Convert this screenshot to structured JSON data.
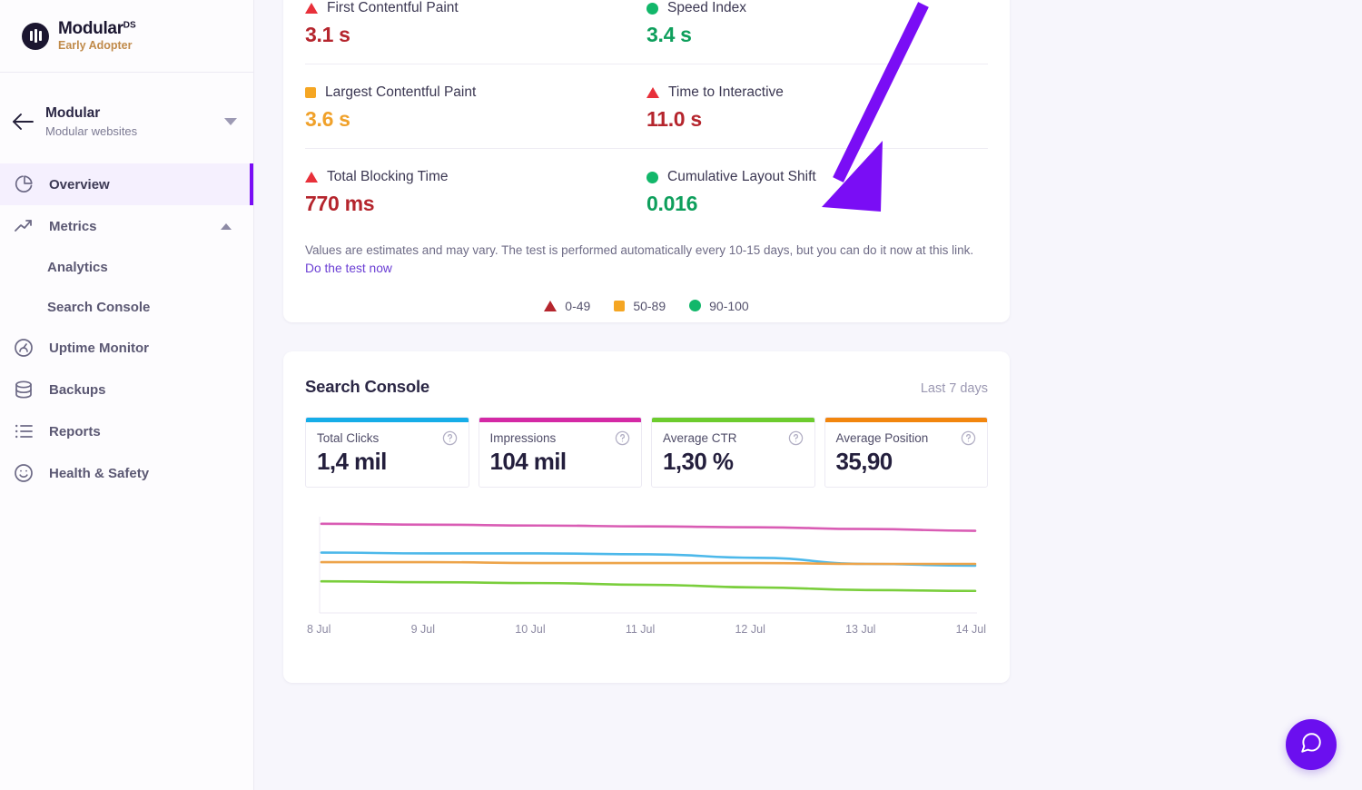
{
  "sidebar": {
    "brand": {
      "name": "Modular",
      "superscript": "DS",
      "tagline": "Early Adopter",
      "logo_icon": "modular-logo-icon"
    },
    "site_switcher": {
      "name": "Modular",
      "subtitle": "Modular websites",
      "back_icon": "arrow-left-icon",
      "caret_icon": "caret-down-icon"
    },
    "items": [
      {
        "label": "Overview",
        "icon": "pie-chart-icon",
        "active": true
      },
      {
        "label": "Metrics",
        "icon": "trending-up-icon",
        "active": false,
        "expanded": true
      },
      {
        "label": "Analytics",
        "icon": "",
        "sub": true
      },
      {
        "label": "Search Console",
        "icon": "",
        "sub": true
      },
      {
        "label": "Uptime Monitor",
        "icon": "gauge-icon",
        "active": false
      },
      {
        "label": "Backups",
        "icon": "database-icon",
        "active": false
      },
      {
        "label": "Reports",
        "icon": "list-icon",
        "active": false
      },
      {
        "label": "Health & Safety",
        "icon": "smiley-icon",
        "active": false
      }
    ]
  },
  "performance": {
    "metrics": [
      {
        "label": "First Contentful Paint",
        "value": "3.1 s",
        "status": "poor",
        "icon": "triangle-icon"
      },
      {
        "label": "Speed Index",
        "value": "3.4 s",
        "status": "good",
        "icon": "circle-icon"
      },
      {
        "label": "Largest Contentful Paint",
        "value": "3.6 s",
        "status": "average",
        "icon": "square-icon"
      },
      {
        "label": "Time to Interactive",
        "value": "11.0 s",
        "status": "poor",
        "icon": "triangle-icon"
      },
      {
        "label": "Total Blocking Time",
        "value": "770 ms",
        "status": "poor",
        "icon": "triangle-icon"
      },
      {
        "label": "Cumulative Layout Shift",
        "value": "0.016",
        "status": "good",
        "icon": "circle-icon"
      }
    ],
    "note": "Values are estimates and may vary. The test is performed automatically every 10-15 days, but you can do it now at this link.",
    "link_label": "Do the test now",
    "legend": [
      {
        "label": "0-49",
        "icon": "triangle-icon",
        "color": "#b5252d"
      },
      {
        "label": "50-89",
        "icon": "square-icon",
        "color": "#f5a623"
      },
      {
        "label": "90-100",
        "icon": "circle-icon",
        "color": "#12b76a"
      }
    ]
  },
  "search_console": {
    "title": "Search Console",
    "range_label": "Last 7 days",
    "help_icon": "question-circle-icon",
    "stats": [
      {
        "label": "Total Clicks",
        "value": "1,4 mil",
        "color": "#16ade8"
      },
      {
        "label": "Impressions",
        "value": "104 mil",
        "color": "#d429a5"
      },
      {
        "label": "Average CTR",
        "value": "1,30 %",
        "color": "#6dcc2e"
      },
      {
        "label": "Average Position",
        "value": "35,90",
        "color": "#f2860e"
      }
    ],
    "chart_data": {
      "type": "line",
      "title": "Search Console",
      "xlabel": "",
      "ylabel": "",
      "grid": false,
      "legend_position": "none",
      "categories": [
        "8 Jul",
        "9 Jul",
        "10 Jul",
        "11 Jul",
        "12 Jul",
        "13 Jul",
        "14 Jul"
      ],
      "series": [
        {
          "name": "Impressions",
          "color": "#d95cb4",
          "values": [
            96,
            95,
            94,
            93,
            92,
            90,
            88
          ]
        },
        {
          "name": "Total Clicks",
          "color": "#4cb8ea",
          "values": [
            63,
            62,
            62,
            61,
            57,
            50,
            48
          ]
        },
        {
          "name": "Average Position",
          "color": "#eda44a",
          "values": [
            52,
            52,
            51,
            51,
            51,
            50,
            50
          ]
        },
        {
          "name": "Average CTR",
          "color": "#7ace3c",
          "values": [
            30,
            29,
            28,
            26,
            23,
            20,
            19
          ]
        }
      ],
      "ylim": [
        0,
        100
      ]
    }
  },
  "annotation": {
    "arrow_color": "#7a0df5",
    "arrow_icon": "pointer-arrow-icon"
  },
  "chat": {
    "icon": "chat-bubble-icon",
    "color": "#6b0fef"
  }
}
